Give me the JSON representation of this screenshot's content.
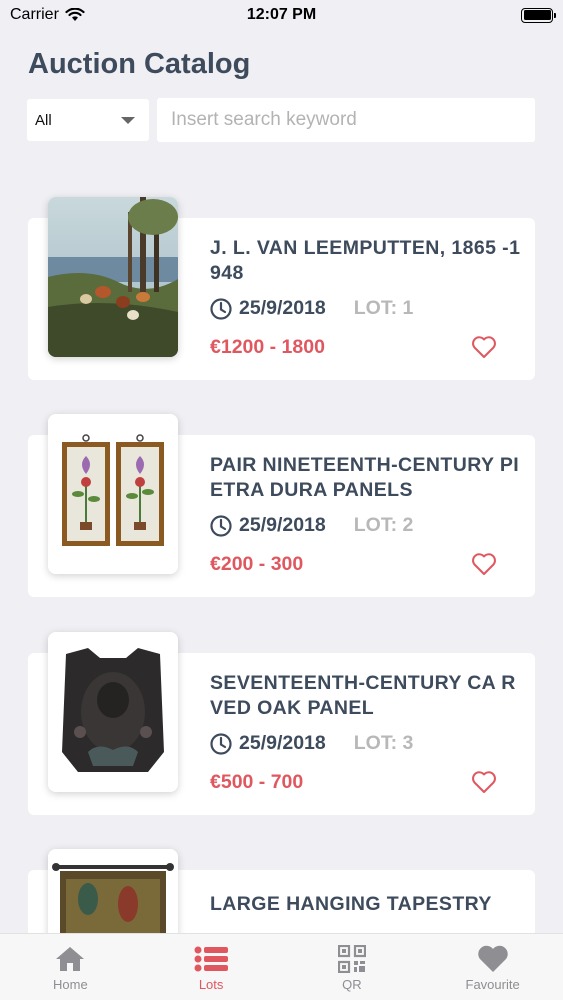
{
  "status": {
    "carrier": "Carrier",
    "time": "12:07 PM"
  },
  "header": {
    "title": "Auction Catalog"
  },
  "filter": {
    "selected": "All"
  },
  "search": {
    "placeholder": "Insert search keyword"
  },
  "lots": [
    {
      "title": "J. L. VAN LEEMPUTTEN, 1865 -1948",
      "date": "25/9/2018",
      "lot": "LOT: 1",
      "price": "€1200 - 1800"
    },
    {
      "title": "PAIR NINETEENTH-CENTURY PIETRA DURA PANELS",
      "date": "25/9/2018",
      "lot": "LOT: 2",
      "price": "€200 - 300"
    },
    {
      "title": "SEVENTEENTH-CENTURY CA RVED OAK PANEL",
      "date": "25/9/2018",
      "lot": "LOT: 3",
      "price": "€500 - 700"
    },
    {
      "title": "LARGE HANGING TAPESTRY",
      "date": "",
      "lot": "",
      "price": ""
    }
  ],
  "tabs": [
    {
      "label": "Home",
      "icon": "home-icon",
      "active": false
    },
    {
      "label": "Lots",
      "icon": "list-icon",
      "active": true
    },
    {
      "label": "QR",
      "icon": "qr-code-icon",
      "active": false
    },
    {
      "label": "Favourite",
      "icon": "heart-icon",
      "active": false
    }
  ],
  "colors": {
    "accent": "#e0585f",
    "title": "#3d4b5c",
    "muted": "#b8b8b8",
    "background": "#efeff4"
  }
}
